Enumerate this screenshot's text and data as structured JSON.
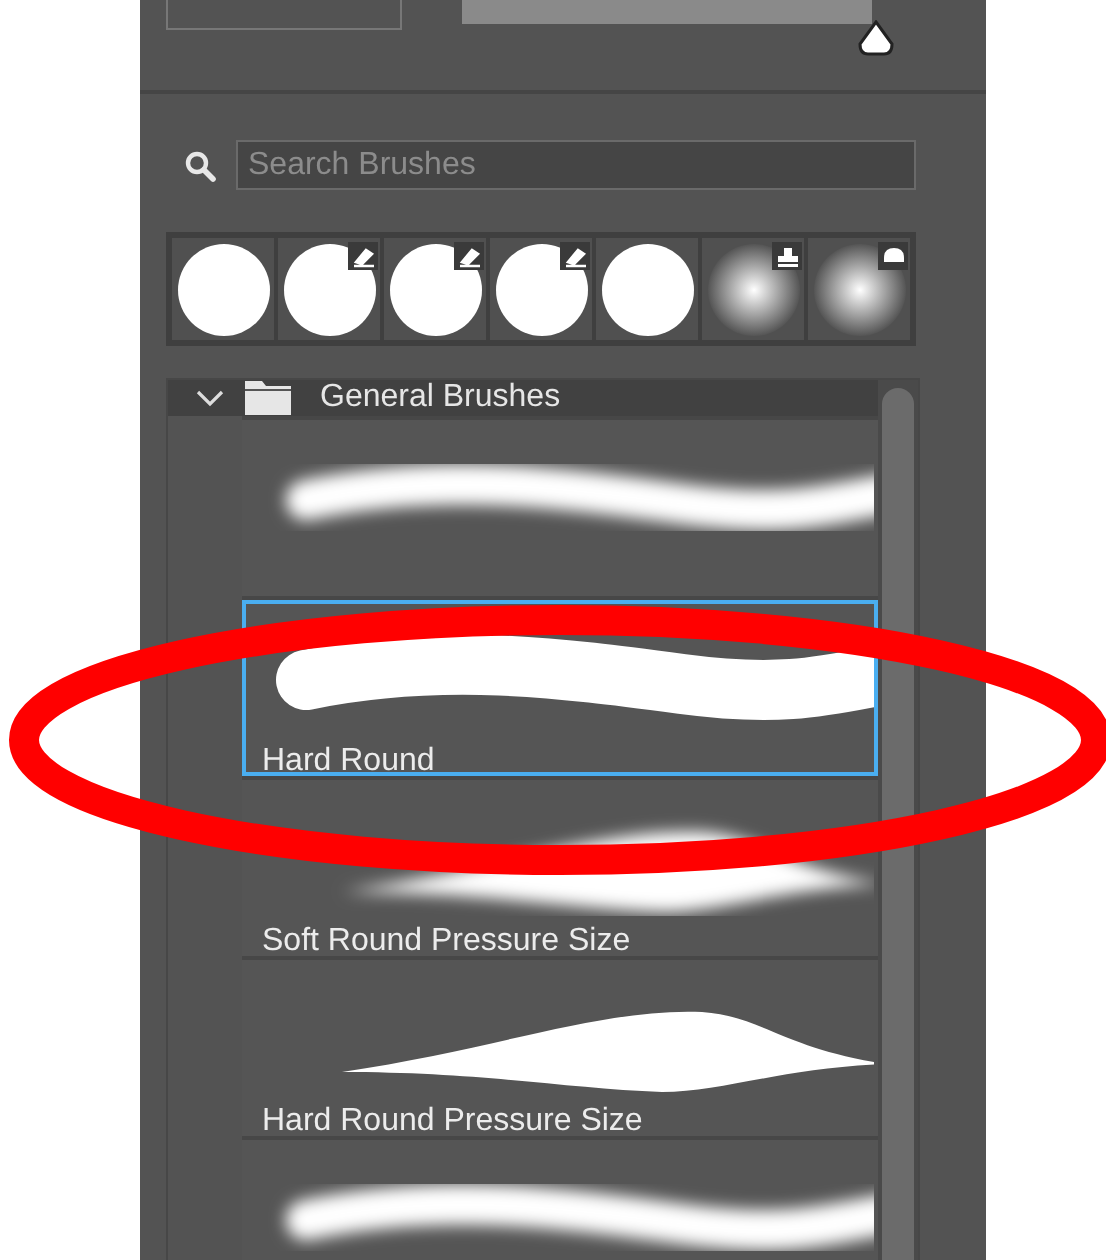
{
  "size_slider": {
    "level": 1
  },
  "search": {
    "placeholder": "Search Brushes"
  },
  "presets": [
    {
      "kind": "hard"
    },
    {
      "kind": "hard-eraser"
    },
    {
      "kind": "hard-eraser"
    },
    {
      "kind": "hard-eraser"
    },
    {
      "kind": "hard"
    },
    {
      "kind": "soft-stamp"
    },
    {
      "kind": "soft-tool"
    }
  ],
  "group": {
    "name": "General Brushes",
    "expanded": true,
    "brushes": [
      {
        "kind": "soft",
        "selected": false
      },
      {
        "kind": "hard",
        "label": "Hard Round",
        "selected": true
      },
      {
        "kind": "soft-pressure",
        "label": "Soft Round Pressure Size",
        "selected": false
      },
      {
        "kind": "hard-pressure",
        "label": "Hard Round Pressure Size",
        "selected": false
      },
      {
        "kind": "soft",
        "selected": false
      }
    ]
  }
}
